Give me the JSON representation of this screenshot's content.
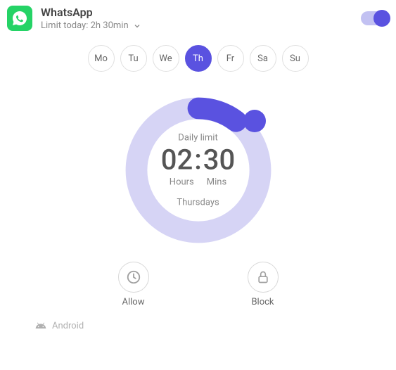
{
  "header": {
    "app_name": "WhatsApp",
    "limit_label": "Limit today: 2h 30min"
  },
  "days": [
    {
      "short": "Mo",
      "selected": false
    },
    {
      "short": "Tu",
      "selected": false
    },
    {
      "short": "We",
      "selected": false
    },
    {
      "short": "Th",
      "selected": true
    },
    {
      "short": "Fr",
      "selected": false
    },
    {
      "short": "Sa",
      "selected": false
    },
    {
      "short": "Su",
      "selected": false
    }
  ],
  "dial": {
    "label": "Daily limit",
    "hours": "02",
    "mins": "30",
    "sep": ":",
    "hours_unit": "Hours",
    "mins_unit": "Mins",
    "dayname": "Thursdays"
  },
  "actions": {
    "allow_label": "Allow",
    "block_label": "Block"
  },
  "footer": {
    "platform": "Android"
  },
  "colors": {
    "accent": "#5a52e0",
    "accent_light": "#d6d4f5",
    "whatsapp": "#25D366"
  }
}
